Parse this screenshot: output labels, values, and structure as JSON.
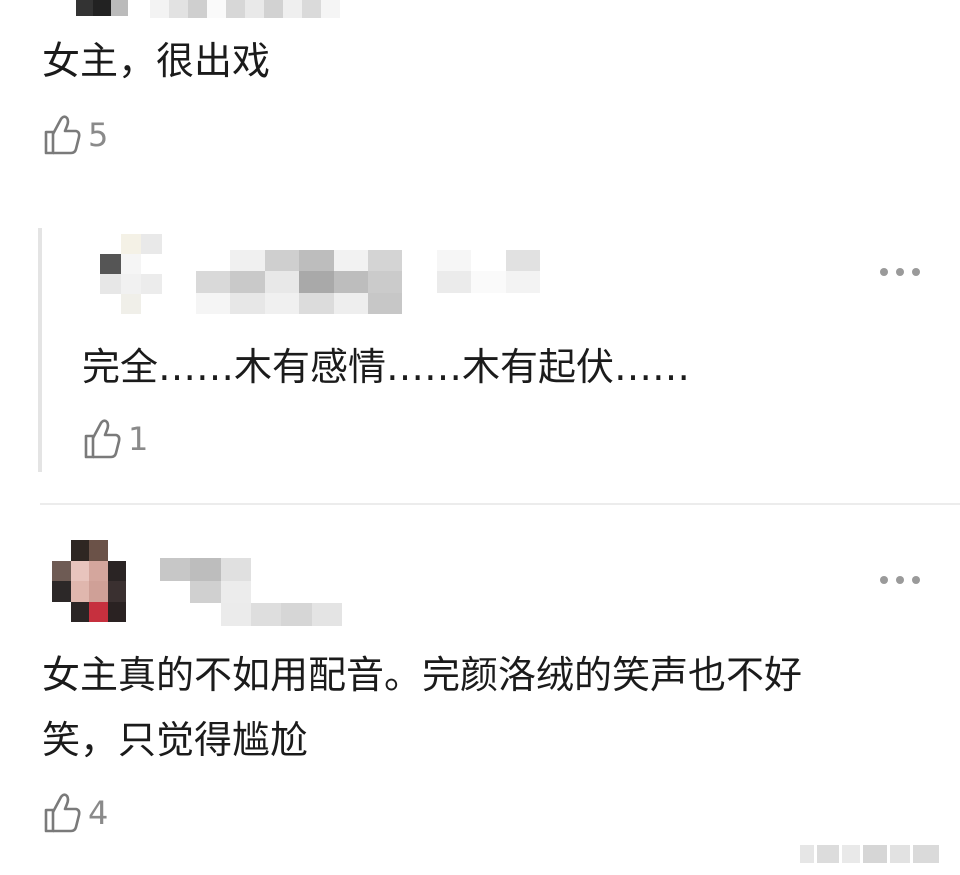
{
  "comments": [
    {
      "text": "女主，很出戏",
      "likes": "5"
    },
    {
      "text": "完全……木有感情……木有起伏……",
      "likes": "1",
      "is_reply": true
    },
    {
      "text_line1": "女主真的不如用配音。完颜洛绒的笑声也不好",
      "text_line2": "笑，只觉得尴尬",
      "likes": "4"
    }
  ],
  "icons": {
    "like": "thumbs-up-icon",
    "more": "more-dots-icon"
  },
  "colors": {
    "text": "#1b1b1b",
    "muted": "#8a8a8a",
    "divider": "#ececec"
  }
}
